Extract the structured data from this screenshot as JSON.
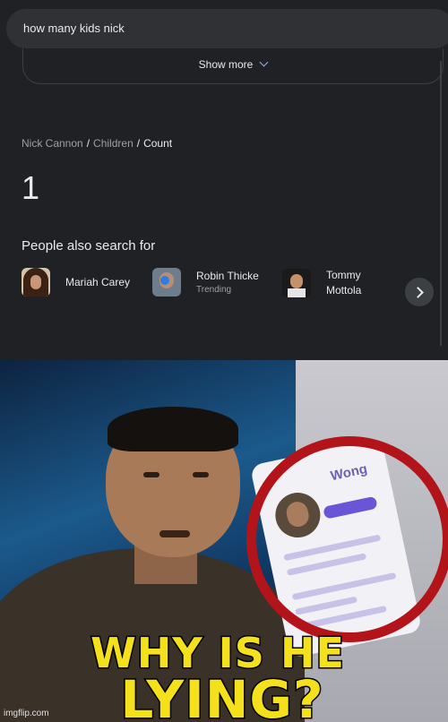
{
  "search": {
    "query": "how many kids nick"
  },
  "show_more": {
    "label": "Show more"
  },
  "breadcrumb": {
    "items": [
      "Nick Cannon",
      "Children",
      "Count"
    ],
    "separator": "/"
  },
  "answer": {
    "value": "1"
  },
  "people_also_search": {
    "title": "People also search for",
    "people": [
      {
        "name": "Mariah Carey",
        "subtitle": ""
      },
      {
        "name": "Robin Thicke",
        "subtitle": "Trending"
      },
      {
        "name": "Tommy",
        "name_line2": "Mottola",
        "subtitle": ""
      }
    ]
  },
  "meme": {
    "caption_line1": "WHY IS HE",
    "caption_line2": "LYING?",
    "phone_name": "Wong",
    "watermark": "imgflip.com"
  },
  "colors": {
    "search_bg": "#202124",
    "caption": "#f5e11b",
    "ring": "#b3141a",
    "accent": "#8ab4f8"
  }
}
